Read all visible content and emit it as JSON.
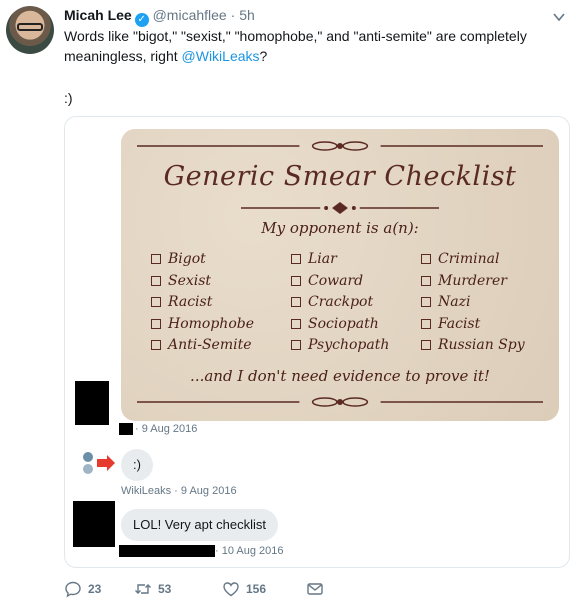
{
  "tweet": {
    "author_name": "Micah Lee",
    "handle": "@micahflee",
    "separator": "·",
    "age": "5h",
    "text_before": "Words like \"bigot,\" \"sexist,\" \"homophobe,\" and \"anti-semite\" are completely meaningless, right ",
    "mention": "@WikiLeaks",
    "text_after": "?",
    "second_line": ":)"
  },
  "checklist": {
    "title": "Generic Smear Checklist",
    "subtitle": "My opponent is a(n):",
    "col1": [
      "Bigot",
      "Sexist",
      "Racist",
      "Homophobe",
      "Anti-Semite"
    ],
    "col2": [
      "Liar",
      "Coward",
      "Crackpot",
      "Sociopath",
      "Psychopath"
    ],
    "col3": [
      "Criminal",
      "Murderer",
      "Nazi",
      "Facist",
      "Russian Spy"
    ],
    "footer": "...and I don't need evidence to prove it!"
  },
  "thread": {
    "msg1_meta": "· 9 Aug 2016",
    "msg2_text": ":)",
    "msg2_meta": "WikiLeaks · 9 Aug 2016",
    "msg3_text": "LOL! Very apt checklist",
    "msg3_meta": "· 10 Aug 2016"
  },
  "actions": {
    "replies": "23",
    "retweets": "53",
    "likes": "156"
  },
  "icons": [
    "verified-icon",
    "chevron-down-icon",
    "reply-icon",
    "retweet-icon",
    "like-icon",
    "direct-message-icon"
  ],
  "colors": {
    "link": "#1b95e0",
    "verified": "#1da1f2",
    "muted": "#657786",
    "checklist_bg": "#e4d5c0",
    "checklist_ink": "#5a2a22"
  }
}
